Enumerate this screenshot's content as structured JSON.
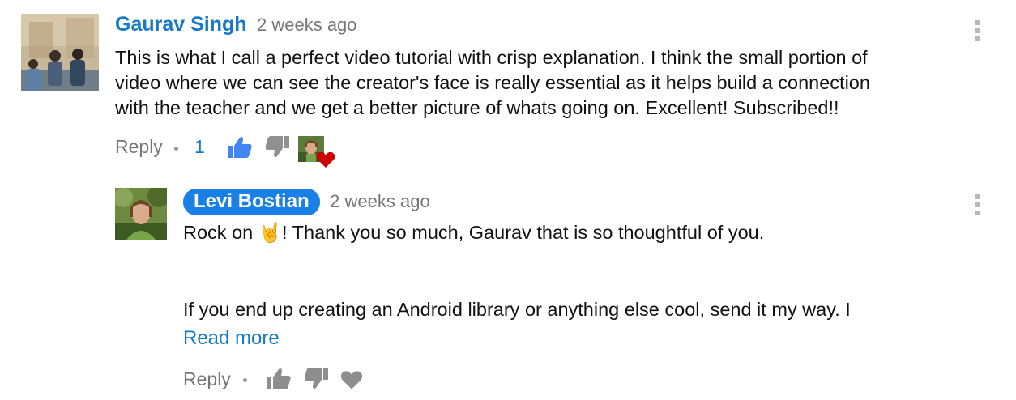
{
  "comments": [
    {
      "author": "Gaurav Singh",
      "timestamp": "2 weeks ago",
      "text_lines": [
        "This is what I call a perfect video tutorial with crisp explanation. I think the small portion of",
        "video where we can see the creator's face is really essential as it helps build a connection",
        "with the teacher and we get a better picture of whats going on. Excellent! Subscribed!!"
      ],
      "reply_label": "Reply",
      "like_count": "1",
      "liked": true,
      "creator_hearted": true,
      "icons": {
        "like": "thumbs-up-icon",
        "dislike": "thumbs-down-icon",
        "heart": "heart-icon",
        "menu": "more-vert-icon"
      },
      "colors": {
        "like_active": "#4285f4",
        "heart": "#cc0000"
      },
      "reply": {
        "author": "Levi Bostian",
        "author_is_creator": true,
        "timestamp": "2 weeks ago",
        "line1_before_emoji": "Rock on ",
        "emoji": "🤘",
        "line1_after_emoji": "! Thank you so much, Gaurav that is so thoughtful of you.",
        "line2": "If you end up creating an Android library or anything else cool, send it my way. I",
        "read_more_label": "Read more",
        "reply_label": "Reply",
        "icons": {
          "like": "thumbs-up-icon",
          "dislike": "thumbs-down-icon",
          "heart": "heart-icon",
          "menu": "more-vert-icon"
        },
        "colors": {
          "creator_chip": "#1a80e5",
          "icon_grey": "#8e8e8e"
        }
      }
    }
  ]
}
